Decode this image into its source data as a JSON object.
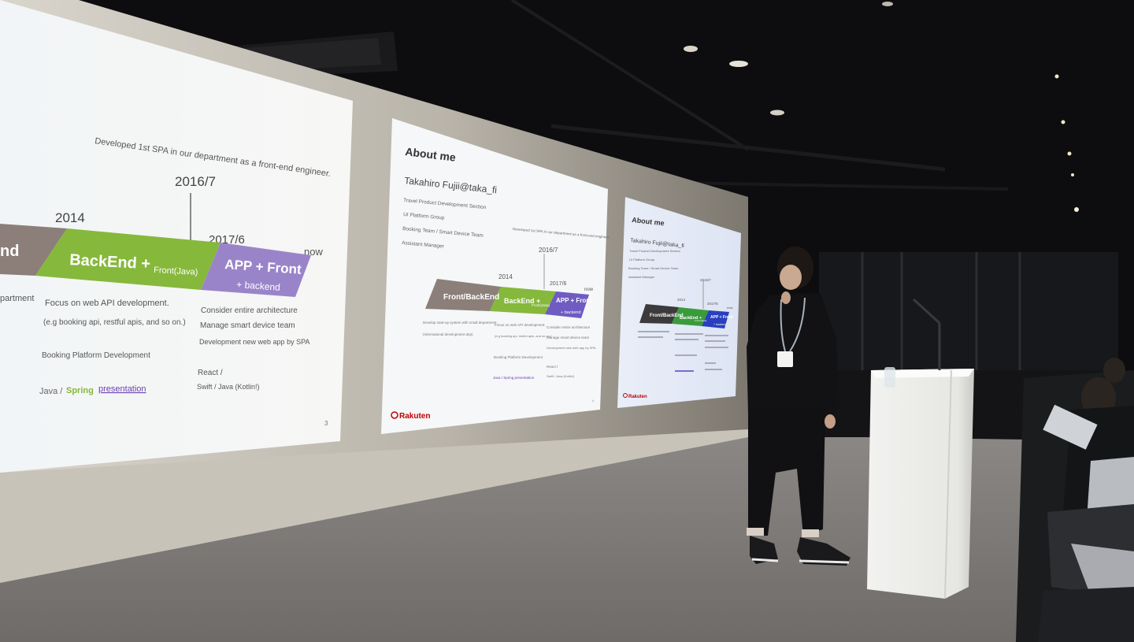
{
  "scene": {
    "description_hidden": true
  },
  "left_slide": {
    "heading": "Developed 1st SPA in our department as a front-end engineer.",
    "years": [
      "2014",
      "2016/7",
      "2017/6",
      "now"
    ],
    "segments": [
      "nd",
      "BackEnd + Front(Java)",
      "APP + Front + backend"
    ],
    "seg_main": [
      "nd",
      "BackEnd +",
      "APP + Front"
    ],
    "seg_sub": [
      "",
      "Front(Java)",
      "+ backend"
    ],
    "col1": [
      "partment"
    ],
    "col2": [
      "Focus on web API development.",
      "(e.g booking api, restful apis, and so on.)",
      "Booking Platform Development"
    ],
    "col3": [
      "Consider entire architecture",
      "Manage smart device team",
      "Development new web app by SPA",
      "React /",
      "Swift / Java (Kotlin!)"
    ],
    "tech_java": "Java / ",
    "tech_spring": "Spring",
    "tech_presentation": "presentation",
    "page_number": "3",
    "colors": {
      "gray": "#8c7f7a",
      "green": "#86b83c",
      "purple": "#9a84c9"
    }
  },
  "center_slide": {
    "title": "About me",
    "name": "Takahiro Fujii@taka_fi",
    "lines": [
      "Travel Product Development Section",
      "UI Platform Group",
      "Booking Team / Smart Device Team",
      "Assistant Manager"
    ],
    "heading": "Developed 1st SPA in our department as a front-end engineer.",
    "years": [
      "2014",
      "2016/7",
      "2017/6",
      "now"
    ],
    "seg_main": [
      "Front/BackEnd",
      "BackEnd +",
      "APP + Front"
    ],
    "seg_sub": [
      "",
      "Front(Java)",
      "+ backend"
    ],
    "col1": [
      "Develop start-up system with small department",
      "(International development dep)"
    ],
    "col2": [
      "Focus on web API development.",
      "(e.g booking api, restful apis, and so on.)",
      "Booking Platform Development",
      "Java / Spring  presentation"
    ],
    "col3": [
      "Consider entire architecture",
      "Manage smart device team",
      "Development new web app by SPA",
      "React /",
      "Swift / Java (Kotlin!)"
    ],
    "brand": "Rakuten",
    "page_number": "4"
  },
  "right_slide": {
    "title": "About me",
    "name": "Takahiro Fujii@taka_fi",
    "lines": [
      "Travel Product Development Section",
      "UI Platform Group",
      "Booking Team / Smart Device Team",
      "Assistant Manager"
    ],
    "years": [
      "2014",
      "2016/7",
      "2017/6",
      "now"
    ],
    "seg_main": [
      "Front/BackEnd",
      "BackEnd +",
      "APP + Front"
    ],
    "seg_sub": [
      "",
      "Front(Java)",
      "+ backend"
    ],
    "brand": "Rakuten"
  }
}
